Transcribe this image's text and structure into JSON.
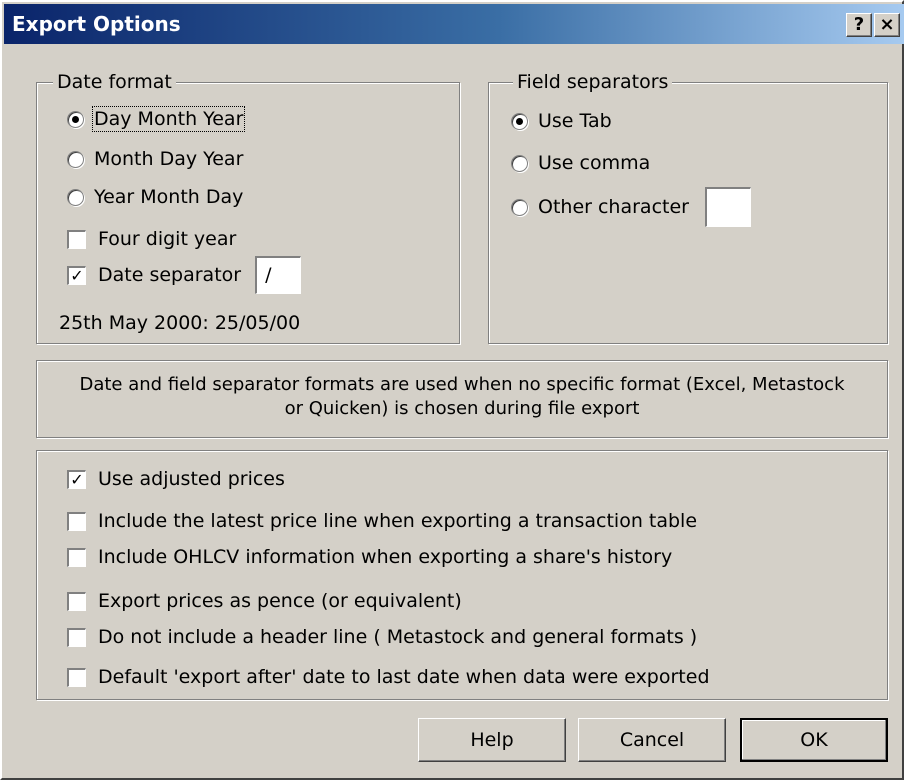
{
  "window": {
    "title": "Export Options",
    "help_glyph": "?",
    "close_glyph": "×"
  },
  "date_format": {
    "group_label": "Date format",
    "options": [
      {
        "label": "Day Month Year",
        "selected": true
      },
      {
        "label": "Month Day Year",
        "selected": false
      },
      {
        "label": "Year Month Day",
        "selected": false
      }
    ],
    "four_digit_year": {
      "label": "Four digit year",
      "checked": false
    },
    "date_separator": {
      "label": "Date separator",
      "checked": true,
      "value": "/"
    },
    "example": "25th May 2000: 25/05/00"
  },
  "field_separators": {
    "group_label": "Field separators",
    "options": [
      {
        "label": "Use Tab",
        "selected": true
      },
      {
        "label": "Use comma",
        "selected": false
      },
      {
        "label": "Other character",
        "selected": false
      }
    ],
    "other_value": ""
  },
  "info": {
    "line1": "Date and field separator formats are used when no specific format (Excel, Metastock",
    "line2": "or Quicken) is chosen during file export"
  },
  "options": [
    {
      "label": "Use adjusted prices",
      "checked": true
    },
    {
      "label": "Include the latest price line when exporting a transaction table",
      "checked": false
    },
    {
      "label": "Include OHLCV information when exporting a share's history",
      "checked": false
    },
    {
      "label": "Export prices as pence (or equivalent)",
      "checked": false
    },
    {
      "label": "Do not include a header line ( Metastock and general formats )",
      "checked": false
    },
    {
      "label": "Default 'export after' date to last date when data were exported",
      "checked": false
    }
  ],
  "buttons": {
    "help": "Help",
    "cancel": "Cancel",
    "ok": "OK"
  }
}
